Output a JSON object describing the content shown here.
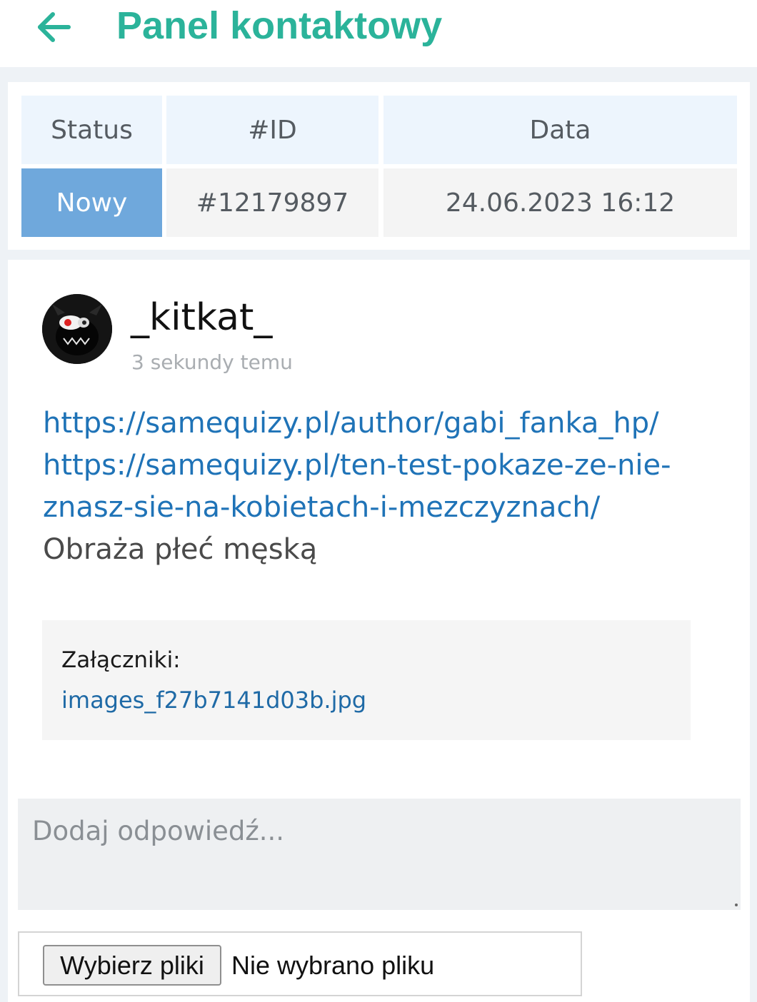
{
  "header": {
    "title": "Panel kontaktowy",
    "back_icon": "arrow-left-icon",
    "accent_color": "#2bb39a"
  },
  "ticket_table": {
    "headers": [
      "Status",
      "#ID",
      "Data"
    ],
    "status": "Nowy",
    "id": "#12179897",
    "date": "24.06.2023 16:12",
    "status_color": "#6fa8dc"
  },
  "message": {
    "author": "_kitkat_",
    "time_ago": "3 sekundy temu",
    "avatar_icon": "avatar-image",
    "links": [
      "https://samequizy.pl/author/gabi_fanka_hp/",
      "https://samequizy.pl/ten-test-pokaze-ze-nie-",
      "znasz-sie-na-kobietach-i-mezczyznach/"
    ],
    "text": "Obraża płeć męską",
    "attachments_label": "Załączniki:",
    "attachment_file": "images_f27b7141d03b.jpg"
  },
  "reply": {
    "placeholder": "Dodaj odpowiedź...",
    "choose_files_label": "Wybierz pliki",
    "no_file_label": "Nie wybrano pliku"
  }
}
